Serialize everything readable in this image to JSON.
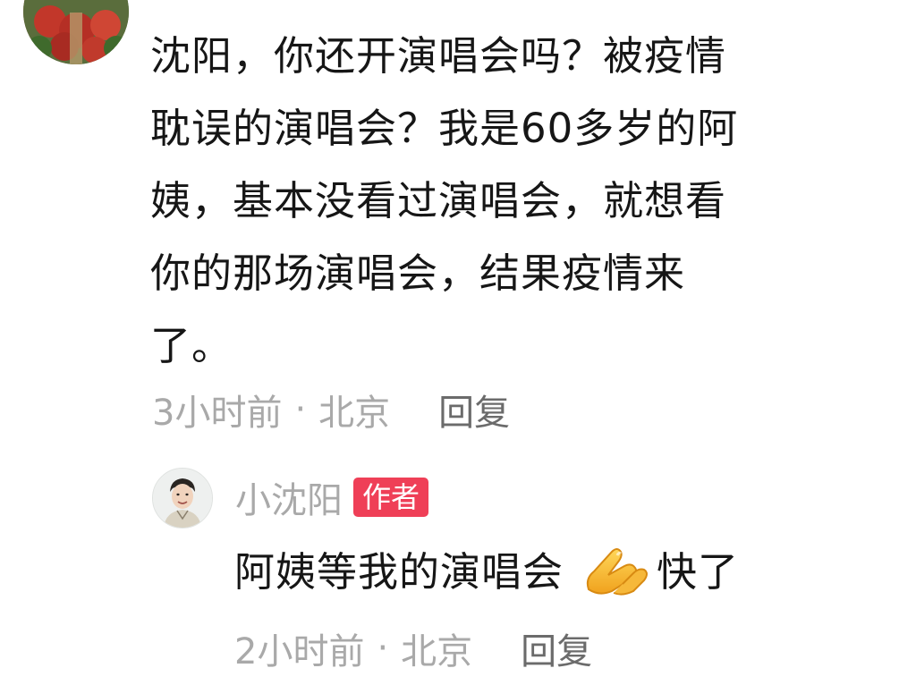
{
  "comment": {
    "avatar_icon": "avatar-photo-flowers",
    "lines": [
      "沈阳，你还开演唱会吗？被疫情",
      "耽误的演唱会？我是60多岁的阿",
      "姨，基本没看过演唱会，就想看",
      "你的那场演唱会，结果疫情来",
      "了。"
    ],
    "time": "3小时前",
    "separator": "·",
    "location": "北京",
    "reply_label": "回复"
  },
  "reply": {
    "avatar_icon": "avatar-photo-man",
    "username": "小沈阳",
    "badge": "作者",
    "text_before_emoji": "阿姨等我的演唱会",
    "emoji_icon": "folded-hands-emoji",
    "text_after_emoji": "快了",
    "time": "2小时前",
    "separator": "·",
    "location": "北京",
    "reply_label": "回复"
  },
  "colors": {
    "text": "#161616",
    "meta": "#a9a9a9",
    "reply_action": "#6b6b6b",
    "badge_bg": "#ef3f57"
  }
}
